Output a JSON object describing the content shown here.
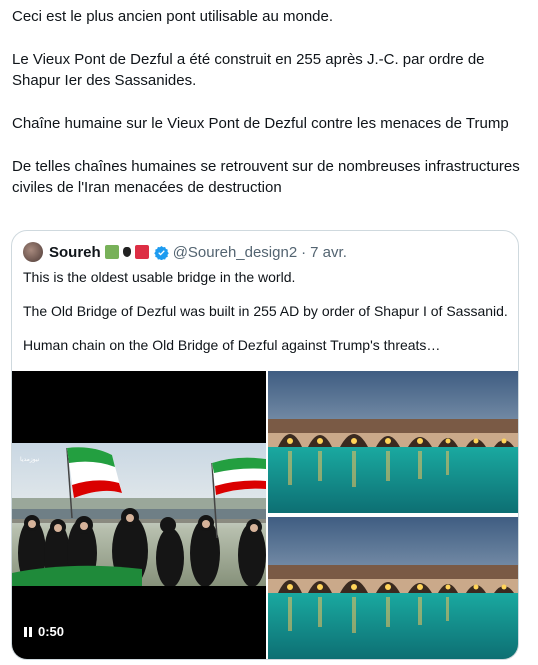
{
  "tweet": {
    "paragraphs": [
      "Ceci est le plus ancien pont utilisable au monde.",
      "Le Vieux Pont de Dezful a été construit en 255 après J.-C. par ordre de Shapur Ier des Sassanides.",
      "Chaîne humaine sur le Vieux Pont de Dezful contre les menaces de Trump",
      "De telles chaînes humaines se retrouvent sur de nombreuses infrastructures civiles de l'Iran menacées de destruction"
    ]
  },
  "quote": {
    "name": "Soureh",
    "handle": "@Soureh_design2",
    "separator": "·",
    "date": "7 avr.",
    "paragraphs": [
      "This is the oldest usable bridge in the world.",
      "The Old Bridge of Dezful was built in 255 AD by order of Shapur I of Sassanid.",
      "Human chain on the Old Bridge of Dezful against Trump's threats…"
    ],
    "video": {
      "duration": "0:50",
      "watermark": "نیوزمدیا"
    },
    "colors": {
      "verified": "#1d9bf0",
      "border": "#cfd9de",
      "handle": "#536471"
    }
  }
}
